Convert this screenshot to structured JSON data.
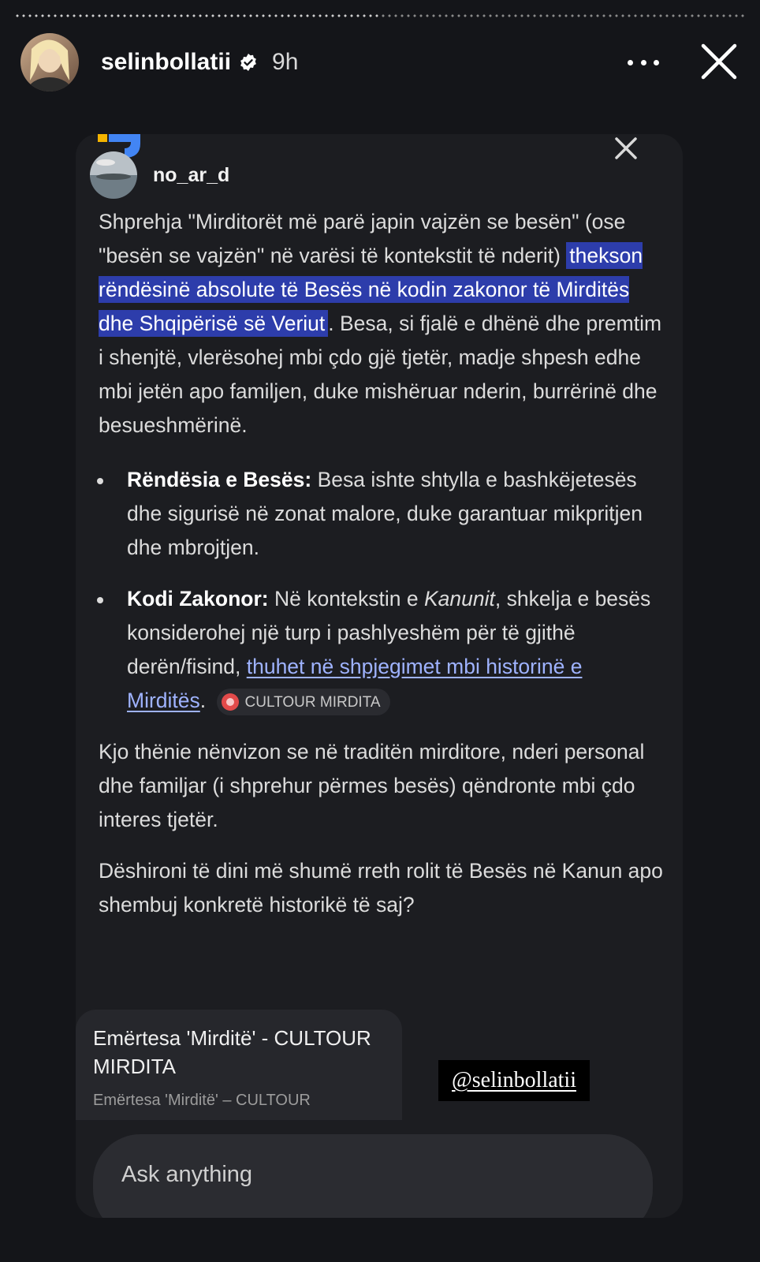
{
  "story": {
    "username": "selinbollatii",
    "time": "9h"
  },
  "card": {
    "poster_name": "no_ar_d",
    "intro_before": "Shprehja \"Mirditorët më parë japin vajzën se besën\" (ose \"besën se vajzën\" në varësi të kontekstit të nderit) ",
    "intro_highlight": "thekson rëndësinë absolute të Besës në kodin zakonor të Mirditës dhe Shqipërisë së Veriut",
    "intro_after": ". Besa, si fjalë e dhënë dhe premtim i shenjtë, vlerësohej mbi çdo gjë tjetër, madje shpesh edhe mbi jetën apo familjen, duke mishëruar nderin, burrërinë dhe besueshmërinë.",
    "bullets": [
      {
        "title": "Rëndësia e Besës:",
        "text": " Besa ishte shtylla e bashkëjetesës dhe sigurisë në zonat malore, duke garantuar mikpritjen dhe mbrojtjen."
      },
      {
        "title": "Kodi Zakonor:",
        "text_before": " Në kontekstin e ",
        "italic": "Kanunit",
        "text_mid": ", shkelja e besës konsiderohej një turp i pashlyeshëm për të gjithë derën/fisind, ",
        "link": "thuhet në shpjegimet mbi historinë e Mirditës",
        "text_after": ".",
        "chip": "CULTOUR MIRDITA"
      }
    ],
    "closing": "Kjo thënie nënvizon se në traditën mirditore, nderi personal dhe familjar (i shprehur përmes besës) qëndronte mbi çdo interes tjetër.",
    "question": "Dëshironi të dini më shumë rreth rolit të Besës në Kanun apo shembuj konkretë historikë të saj?",
    "source_title": "Emërtesa 'Mirditë' - CULTOUR MIRDITA",
    "source_sub": "Emërtesa 'Mirditë' – CULTOUR",
    "mention_tag": "@selinbollatii",
    "ask_placeholder": "Ask anything"
  },
  "colors": {
    "highlight": "#2d3dab",
    "link": "#9fb3ff",
    "background": "#141519"
  },
  "icons": [
    "verified-badge-icon",
    "more-options-icon",
    "close-icon",
    "google-logo-icon",
    "source-favicon-icon"
  ]
}
